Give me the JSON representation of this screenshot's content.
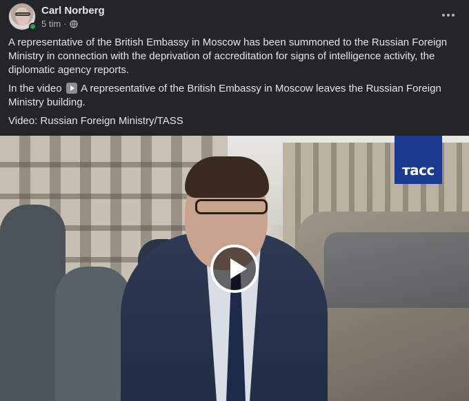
{
  "post": {
    "author": "Carl Norberg",
    "time": "5 tim",
    "separator": "·",
    "privacy_icon": "globe-icon",
    "more_icon": "more-options-icon",
    "paragraphs": {
      "p1": "A representative of the British Embassy in Moscow has been summoned to the Russian Foreign Ministry in connection with the deprivation of accreditation for signs of intelligence activity, the diplomatic agency reports.",
      "p2_before": "In the video",
      "p2_after": "A representative of the British Embassy in Moscow leaves the Russian Foreign Ministry building.",
      "p3": "Video: Russian Foreign Ministry/TASS"
    }
  },
  "video": {
    "watermark": "тасс",
    "play_icon": "play-icon"
  },
  "colors": {
    "background": "#242526",
    "text": "#e4e6eb",
    "secondary_text": "#b0b3b8",
    "online": "#31a24c",
    "tass_blue": "#1a3b8f"
  }
}
